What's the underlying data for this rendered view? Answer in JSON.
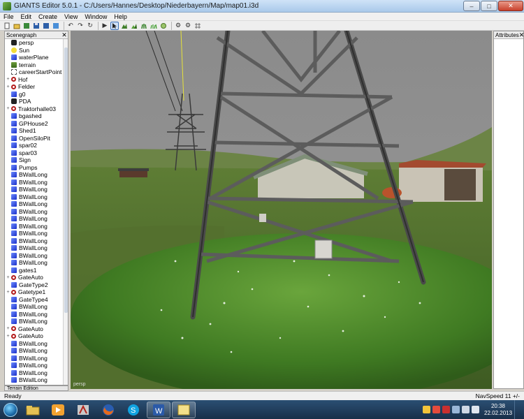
{
  "window": {
    "title": "GIANTS Editor 5.0.1 - C:/Users/Hannes/Desktop/Niederbayern/Map/map01.i3d",
    "controls": [
      "–",
      "□",
      "✕"
    ]
  },
  "menu": [
    "File",
    "Edit",
    "Create",
    "View",
    "Window",
    "Help"
  ],
  "scenegraph": {
    "title": "Scenegraph",
    "items": [
      {
        "label": "persp",
        "icon": "camera-icon",
        "expand": ""
      },
      {
        "label": "Sun",
        "icon": "light-icon",
        "expand": ""
      },
      {
        "label": "waterPlane",
        "icon": "cube-icon",
        "expand": ""
      },
      {
        "label": "terrain",
        "icon": "terrain-icon",
        "expand": ""
      },
      {
        "label": "careerStartPoint",
        "icon": "transform-icon",
        "expand": ""
      },
      {
        "label": "Hof",
        "icon": "group-icon",
        "expand": "+"
      },
      {
        "label": "Felder",
        "icon": "group-icon",
        "expand": "+"
      },
      {
        "label": "g0",
        "icon": "cube-icon",
        "expand": ""
      },
      {
        "label": "PDA",
        "icon": "camera-icon",
        "expand": ""
      },
      {
        "label": "Traktorhalle03",
        "icon": "group-icon",
        "expand": "+"
      },
      {
        "label": "bgashed",
        "icon": "cube-icon",
        "expand": ""
      },
      {
        "label": "GPHouse2",
        "icon": "cube-icon",
        "expand": ""
      },
      {
        "label": "Shed1",
        "icon": "cube-icon",
        "expand": ""
      },
      {
        "label": "OpenSiloPit",
        "icon": "cube-icon",
        "expand": ""
      },
      {
        "label": "spar02",
        "icon": "cube-icon",
        "expand": ""
      },
      {
        "label": "spar03",
        "icon": "cube-icon",
        "expand": ""
      },
      {
        "label": "Sign",
        "icon": "cube-icon",
        "expand": ""
      },
      {
        "label": "Pumps",
        "icon": "cube-icon",
        "expand": ""
      },
      {
        "label": "BWallLong",
        "icon": "cube-icon",
        "expand": ""
      },
      {
        "label": "BWallLong",
        "icon": "cube-icon",
        "expand": ""
      },
      {
        "label": "BWallLong",
        "icon": "cube-icon",
        "expand": ""
      },
      {
        "label": "BWallLong",
        "icon": "cube-icon",
        "expand": ""
      },
      {
        "label": "BWallLong",
        "icon": "cube-icon",
        "expand": ""
      },
      {
        "label": "BWallLong",
        "icon": "cube-icon",
        "expand": ""
      },
      {
        "label": "BWallLong",
        "icon": "cube-icon",
        "expand": ""
      },
      {
        "label": "BWallLong",
        "icon": "cube-icon",
        "expand": ""
      },
      {
        "label": "BWallLong",
        "icon": "cube-icon",
        "expand": ""
      },
      {
        "label": "BWallLong",
        "icon": "cube-icon",
        "expand": ""
      },
      {
        "label": "BWallLong",
        "icon": "cube-icon",
        "expand": ""
      },
      {
        "label": "BWallLong",
        "icon": "cube-icon",
        "expand": ""
      },
      {
        "label": "BWallLong",
        "icon": "cube-icon",
        "expand": ""
      },
      {
        "label": "gates1",
        "icon": "cube-icon",
        "expand": ""
      },
      {
        "label": "GateAuto",
        "icon": "group-icon",
        "expand": "+"
      },
      {
        "label": "GateType2",
        "icon": "cube-icon",
        "expand": ""
      },
      {
        "label": "Gatetype1",
        "icon": "group-icon",
        "expand": "+"
      },
      {
        "label": "GateType4",
        "icon": "cube-icon",
        "expand": ""
      },
      {
        "label": "BWallLong",
        "icon": "cube-icon",
        "expand": ""
      },
      {
        "label": "BWallLong",
        "icon": "cube-icon",
        "expand": ""
      },
      {
        "label": "BWallLong",
        "icon": "cube-icon",
        "expand": ""
      },
      {
        "label": "GateAuto",
        "icon": "group-icon",
        "expand": "+"
      },
      {
        "label": "GateAuto",
        "icon": "group-icon",
        "expand": "+"
      },
      {
        "label": "BWallLong",
        "icon": "cube-icon",
        "expand": ""
      },
      {
        "label": "BWallLong",
        "icon": "cube-icon",
        "expand": ""
      },
      {
        "label": "BWallLong",
        "icon": "cube-icon",
        "expand": ""
      },
      {
        "label": "BWallLong",
        "icon": "cube-icon",
        "expand": ""
      },
      {
        "label": "BWallLong",
        "icon": "cube-icon",
        "expand": ""
      },
      {
        "label": "BWallLong",
        "icon": "cube-icon",
        "expand": ""
      }
    ]
  },
  "terrain_tab": "Terrain Edition",
  "viewport": {
    "label": "persp"
  },
  "attributes": {
    "title": "Attributes"
  },
  "status": {
    "left": "Ready",
    "right": "NavSpeed 11 +/-"
  },
  "taskbar": {
    "time": "20:38",
    "date": "22.02.2013"
  }
}
